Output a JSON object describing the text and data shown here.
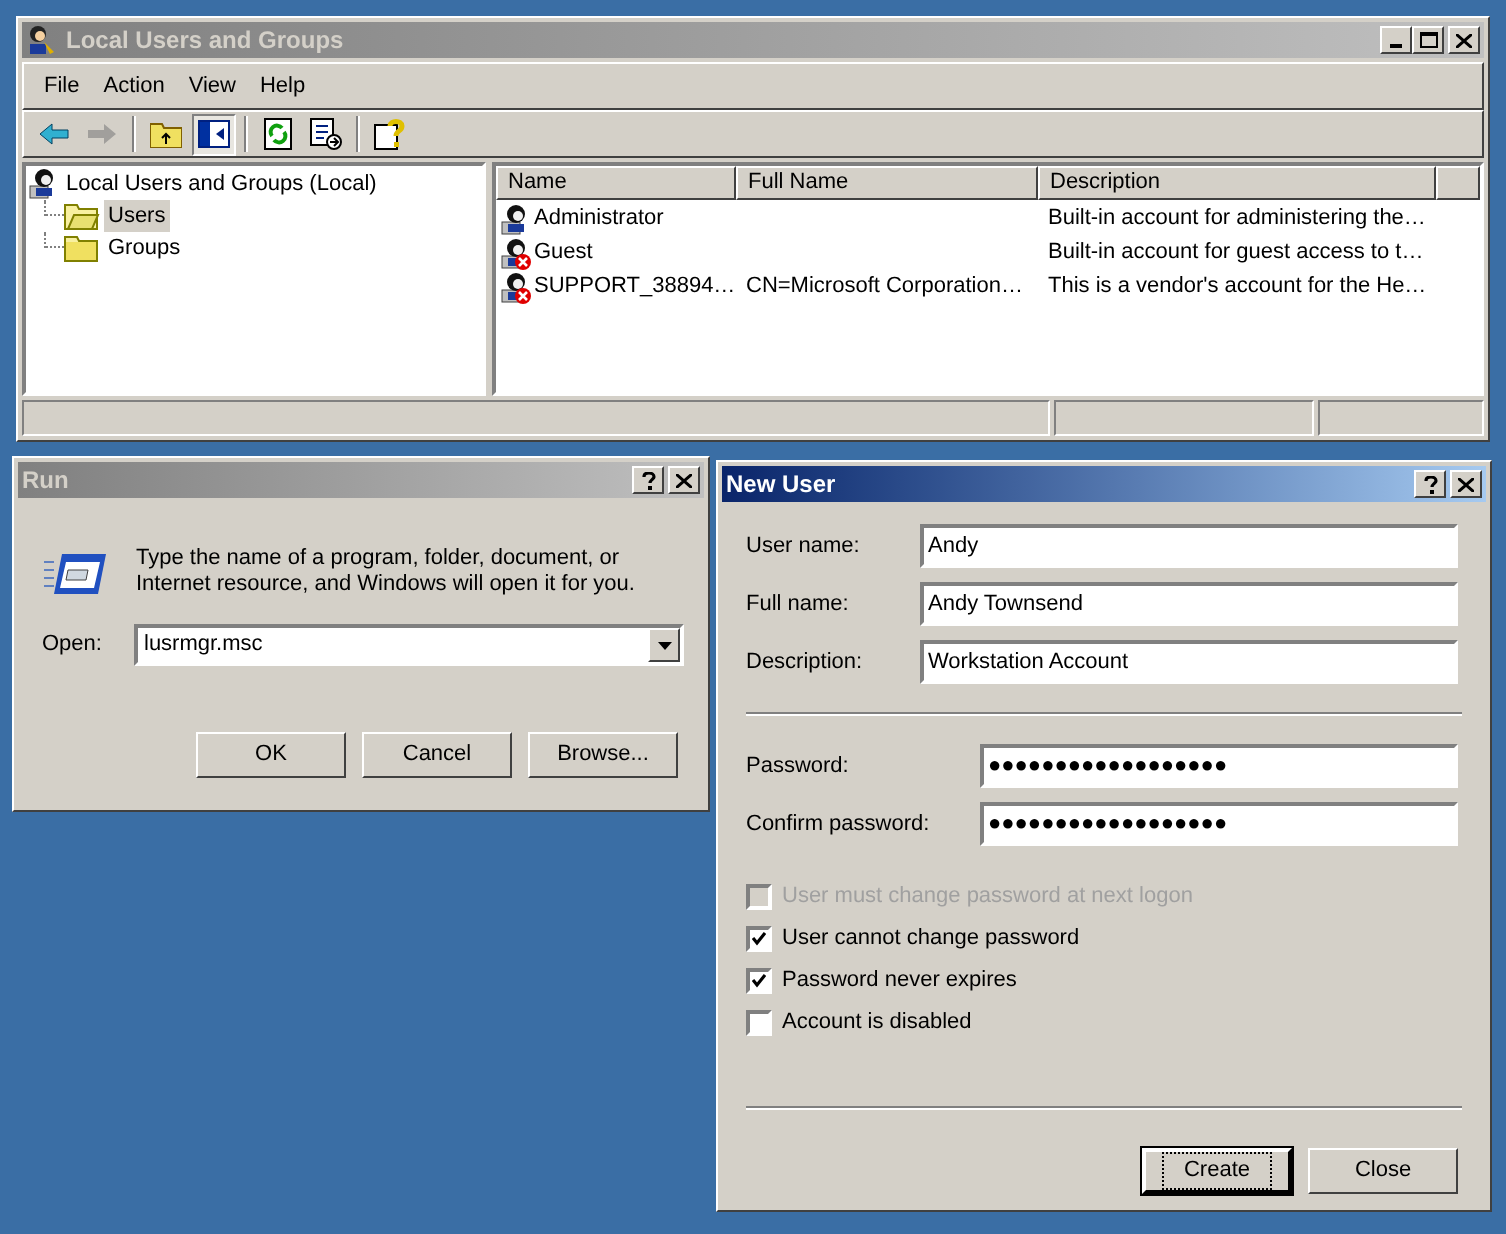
{
  "main_window": {
    "title": "Local Users and Groups",
    "active": false,
    "menu": [
      "File",
      "Action",
      "View",
      "Help"
    ],
    "toolbar": [
      {
        "kind": "back",
        "disabled": false,
        "pressed": false
      },
      {
        "kind": "forward",
        "disabled": true,
        "pressed": false
      },
      {
        "kind": "separator"
      },
      {
        "kind": "up",
        "disabled": false,
        "pressed": false
      },
      {
        "kind": "tree",
        "disabled": false,
        "pressed": true
      },
      {
        "kind": "separator"
      },
      {
        "kind": "refresh",
        "disabled": false,
        "pressed": false
      },
      {
        "kind": "export",
        "disabled": false,
        "pressed": false
      },
      {
        "kind": "separator"
      },
      {
        "kind": "help",
        "disabled": false,
        "pressed": false
      }
    ],
    "tree": {
      "label": "Local Users and Groups (Local)",
      "children": [
        {
          "label": "Users",
          "selected": true
        },
        {
          "label": "Groups",
          "selected": false
        }
      ]
    },
    "table": {
      "columns": [
        "Name",
        "Full Name",
        "Description"
      ],
      "rows": [
        {
          "name": "Administrator",
          "full_name": "",
          "description": "Built-in account for administering the…",
          "disabled": false
        },
        {
          "name": "Guest",
          "full_name": "",
          "description": "Built-in account for guest access to t…",
          "disabled": true
        },
        {
          "name": "SUPPORT_38894…",
          "full_name": "CN=Microsoft Corporation…",
          "description": "This is a vendor's account for the He…",
          "disabled": true
        }
      ]
    }
  },
  "run_dialog": {
    "title": "Run",
    "active": false,
    "message": "Type the name of a program, folder, document, or Internet resource, and Windows will open it for you.",
    "open_label": "Open:",
    "open_value": "lusrmgr.msc",
    "buttons": [
      {
        "label": "OK",
        "default": false
      },
      {
        "label": "Cancel",
        "default": false
      },
      {
        "label": "Browse...",
        "default": false
      }
    ]
  },
  "new_user_dialog": {
    "title": "New User",
    "active": true,
    "fields": [
      {
        "label": "User name:",
        "value": "Andy"
      },
      {
        "label": "Full name:",
        "value": "Andy Townsend"
      },
      {
        "label": "Description:",
        "value": "Workstation Account"
      }
    ],
    "password_fields": [
      {
        "label": "Password:",
        "value": "●●●●●●●●●●●●●●●●●●"
      },
      {
        "label": "Confirm password:",
        "value": "●●●●●●●●●●●●●●●●●●"
      }
    ],
    "options": [
      {
        "label": "User must change password at next logon",
        "checked": false,
        "disabled": true
      },
      {
        "label": "User cannot change password",
        "checked": true,
        "disabled": false
      },
      {
        "label": "Password never expires",
        "checked": true,
        "disabled": false
      },
      {
        "label": "Account is disabled",
        "checked": false,
        "disabled": false
      }
    ],
    "buttons": [
      {
        "label": "Create",
        "default": true
      },
      {
        "label": "Close",
        "default": false
      }
    ]
  }
}
